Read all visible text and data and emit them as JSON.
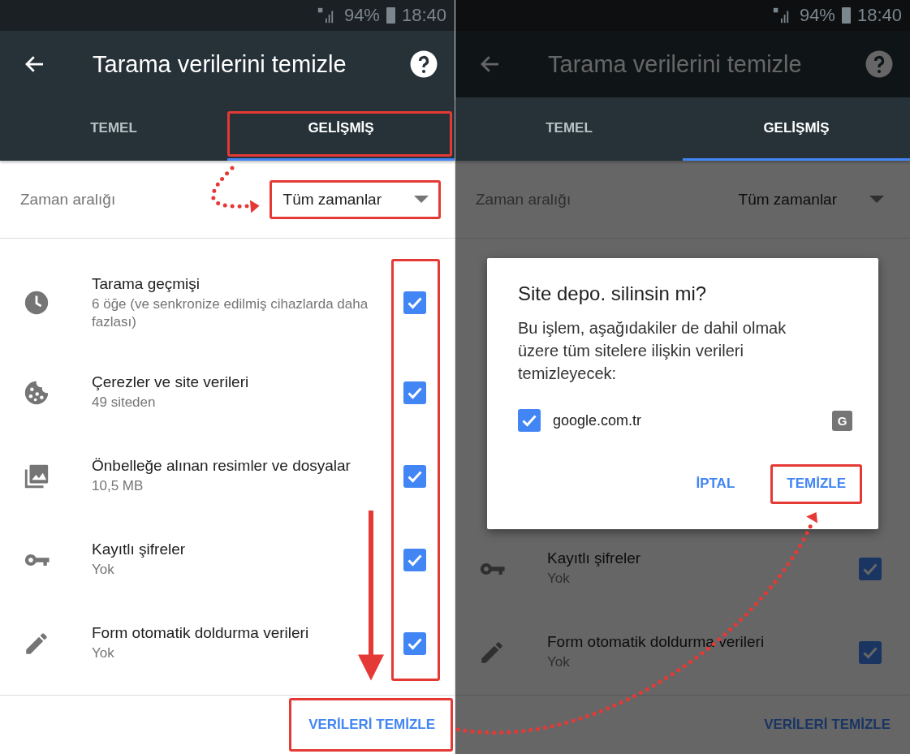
{
  "screens": [
    {
      "dimmed": false,
      "status_bar": {
        "battery": "94%",
        "time": "18:40"
      },
      "toolbar": {
        "title": "Tarama verilerini temizle"
      },
      "tabs": [
        {
          "label": "TEMEL",
          "selected": false,
          "highlighted": false
        },
        {
          "label": "GELİŞMİŞ",
          "selected": true,
          "highlighted": true
        }
      ],
      "time_range": {
        "label": "Zaman aralığı",
        "value": "Tüm zamanlar",
        "highlighted": true
      },
      "items": [
        {
          "kind": "history",
          "title": "Tarama geçmişi",
          "subtitle": "6 öğe (ve senkronize edilmiş cihazlarda daha fazlası)",
          "checked": true
        },
        {
          "kind": "cookies",
          "title": "Çerezler ve site verileri",
          "subtitle": "49 siteden",
          "checked": true
        },
        {
          "kind": "images",
          "title": "Önbelleğe alınan resimler ve dosyalar",
          "subtitle": "10,5 MB",
          "checked": true
        },
        {
          "kind": "passwords",
          "title": "Kayıtlı şifreler",
          "subtitle": "Yok",
          "checked": true
        },
        {
          "kind": "autofill",
          "title": "Form otomatik doldurma verileri",
          "subtitle": "Yok",
          "checked": true
        }
      ],
      "checkboxes_highlighted": true,
      "clear_button": {
        "label": "VERİLERİ TEMİZLE",
        "highlighted": true
      }
    },
    {
      "dimmed": true,
      "status_bar": {
        "battery": "94%",
        "time": "18:40"
      },
      "toolbar": {
        "title": "Tarama verilerini temizle"
      },
      "tabs": [
        {
          "label": "TEMEL",
          "selected": false,
          "highlighted": false
        },
        {
          "label": "GELİŞMİŞ",
          "selected": true,
          "highlighted": false
        }
      ],
      "time_range": {
        "label": "Zaman aralığı",
        "value": "Tüm zamanlar",
        "highlighted": false
      },
      "items": [
        {
          "kind": "passwords",
          "title": "Kayıtlı şifreler",
          "subtitle": "Yok",
          "checked": true
        },
        {
          "kind": "autofill",
          "title": "Form otomatik doldurma verileri",
          "subtitle": "Yok",
          "checked": true
        }
      ],
      "checkboxes_highlighted": false,
      "clear_button": {
        "label": "VERİLERİ TEMİZLE",
        "highlighted": false
      },
      "dialog": {
        "title": "Site depo. silinsin mi?",
        "message": "Bu işlem, aşağıdakiler de dahil olmak üzere tüm sitelere ilişkin verileri temizleyecek:",
        "sites": [
          {
            "name": "google.com.tr",
            "badge": "G",
            "checked": true
          }
        ],
        "buttons": [
          {
            "label": "İPTAL",
            "highlighted": false
          },
          {
            "label": "TEMİZLE",
            "highlighted": true
          }
        ]
      }
    }
  ]
}
